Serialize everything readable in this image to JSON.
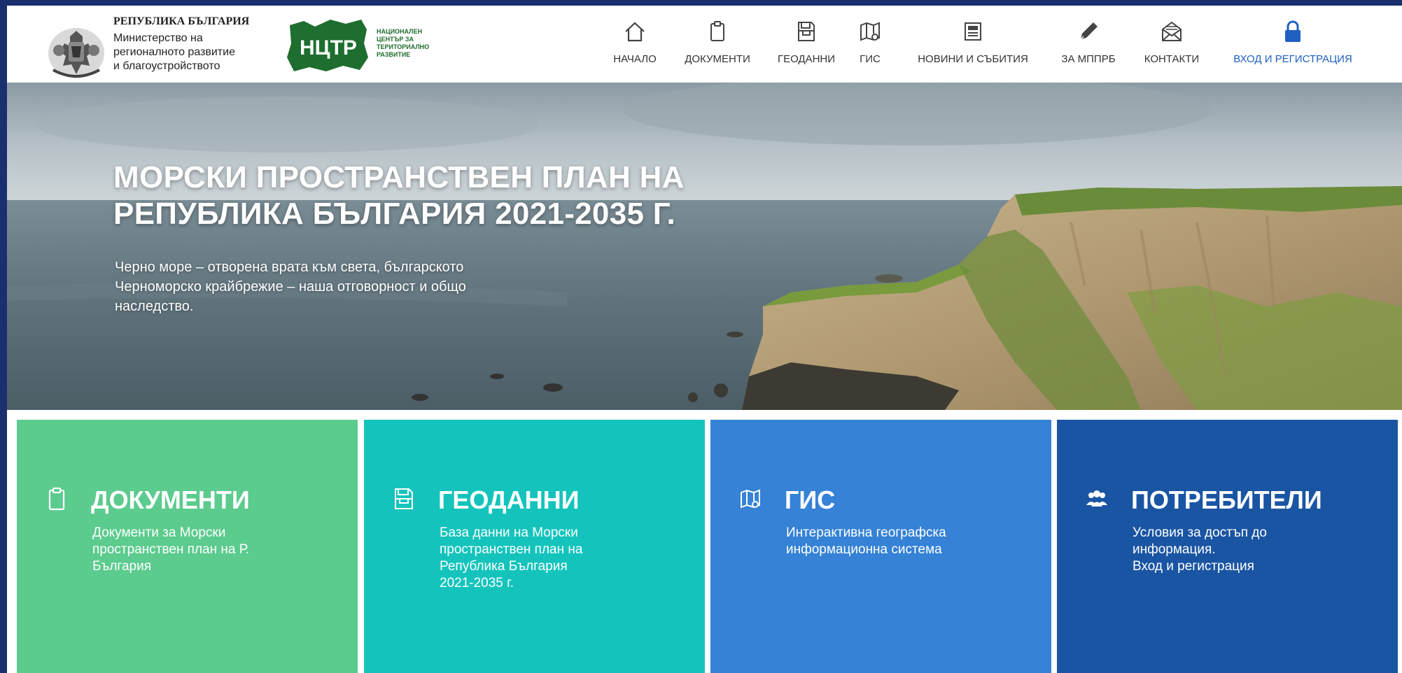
{
  "header": {
    "ministry": {
      "top": "РЕПУБЛИКА БЪЛГАРИЯ",
      "lines": [
        "Министерство на",
        "регионалното развитие",
        "и благоустройството"
      ]
    },
    "nctr": {
      "logo_text": "НЦТР",
      "lines": [
        "НАЦИОНАЛЕН",
        "ЦЕНТЪР ЗА",
        "ТЕРИТОРИАЛНО",
        "РАЗВИТИЕ"
      ]
    }
  },
  "nav": [
    {
      "label": "НАЧАЛО",
      "icon": "home-icon"
    },
    {
      "label": "ДОКУМЕНТИ",
      "icon": "clipboard-icon"
    },
    {
      "label": "ГЕОДАННИ",
      "icon": "inbox-icon"
    },
    {
      "label": "ГИС",
      "icon": "map-icon"
    },
    {
      "label": "НОВИНИ И СЪБИТИЯ",
      "icon": "newspaper-icon"
    },
    {
      "label": "ЗА МППРБ",
      "icon": "pen-icon"
    },
    {
      "label": "КОНТАКТИ",
      "icon": "envelope-icon"
    },
    {
      "label": "ВХОД И РЕГИСТРАЦИЯ",
      "icon": "lock-icon"
    }
  ],
  "hero": {
    "title_lines": [
      "МОРСКИ ПРОСТРАНСТВЕН ПЛАН НА",
      "РЕПУБЛИКА БЪЛГАРИЯ 2021-2035 Г."
    ],
    "subtitle_lines": [
      "Черно море – отворена врата към света, българското",
      "Черноморско крайбрежие – наша отговорност и общо",
      "наследство."
    ]
  },
  "tiles": [
    {
      "title": "ДОКУМЕНТИ",
      "icon": "clipboard-icon",
      "color": "#5ccb8e",
      "desc": [
        "Документи за Морски",
        "пространствен план на Р.",
        "България"
      ]
    },
    {
      "title": "ГЕОДАННИ",
      "icon": "inbox-icon",
      "color": "#14c4bc",
      "desc": [
        "База данни на Морски",
        "пространствен план на",
        "Република България",
        "2021-2035 г."
      ]
    },
    {
      "title": "ГИС",
      "icon": "map-icon",
      "color": "#3582d6",
      "desc": [
        "Интерактивна географска",
        "информационна система"
      ]
    },
    {
      "title": "ПОТРЕБИТЕЛИ",
      "icon": "users-icon",
      "color": "#1a55a3",
      "desc": [
        "Условия за достъп до",
        "информация.",
        "Вход и регистрация"
      ]
    }
  ],
  "colors": {
    "frame": "#1a2f6e",
    "login": "#2060c0"
  }
}
